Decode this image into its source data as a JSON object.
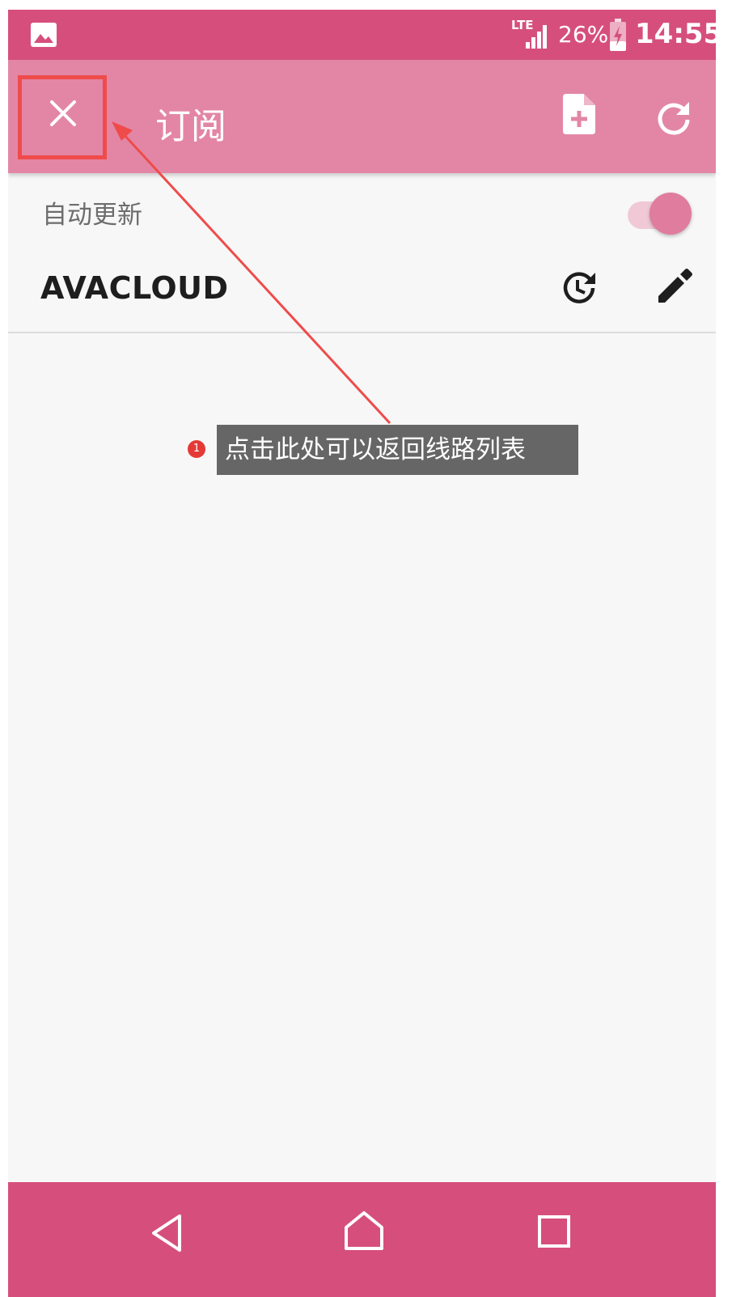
{
  "status_bar": {
    "notification_icon": "image-icon",
    "network": "LTE",
    "battery_percent": "26%",
    "time": "14:55"
  },
  "app_bar": {
    "close_icon": "close-icon",
    "title": "订阅",
    "actions": [
      "add-file-icon",
      "refresh-icon"
    ]
  },
  "settings": {
    "auto_update_label": "自动更新",
    "auto_update_enabled": true
  },
  "subscription": {
    "name": "AVACLOUD",
    "actions": [
      "update-history-icon",
      "edit-icon"
    ]
  },
  "annotation": {
    "badge": "1",
    "text": "点击此处可以返回线路列表",
    "color": "#ef4b4b"
  },
  "nav_bar": {
    "buttons": [
      "back-icon",
      "home-icon",
      "recents-icon"
    ]
  },
  "colors": {
    "status_bar": "#d64f7c",
    "app_bar": "#e386a5",
    "nav_bar": "#d64f7c",
    "accent": "#e07c9d"
  }
}
